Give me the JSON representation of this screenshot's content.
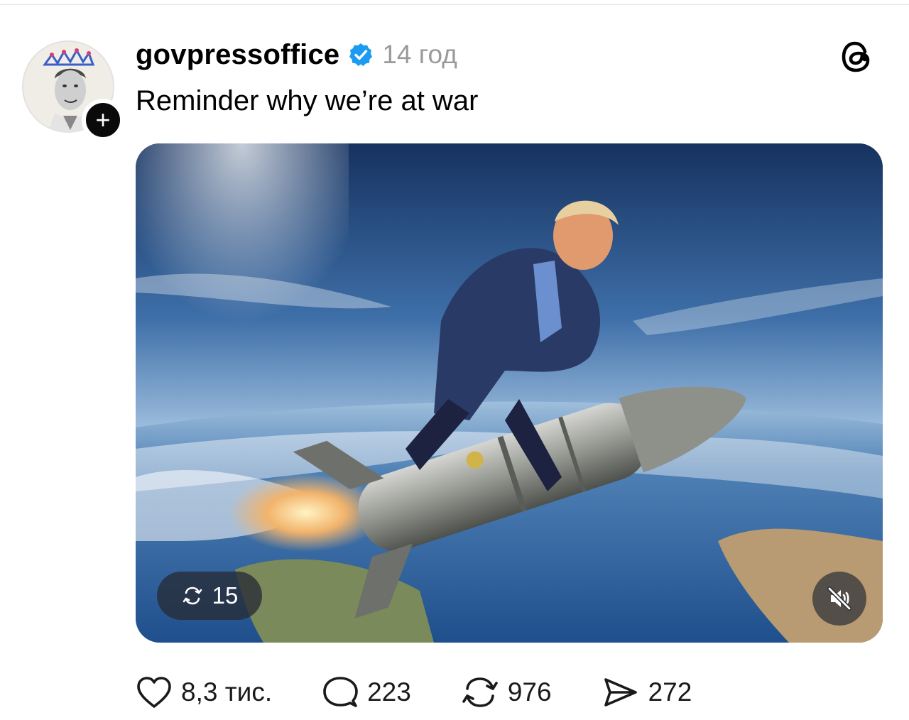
{
  "post": {
    "username": "govpressoffice",
    "time": "14 год",
    "text": "Reminder why we’re at war"
  },
  "media": {
    "repost_count": "15"
  },
  "actions": {
    "likes": "8,3 тис.",
    "comments": "223",
    "reposts": "976",
    "shares": "272"
  },
  "colors": {
    "verified": "#1d9bf0",
    "text": "#000000",
    "muted": "#9a9a9a",
    "sky_top": "#1d3f73",
    "sky_horizon": "#a8c6e2",
    "ocean": "#2c5d94"
  },
  "icons": {
    "avatar": "crowned-portrait",
    "follow": "plus-icon",
    "verified": "verified-badge-icon",
    "threads": "threads-logo-icon",
    "repost_chip": "repost-icon",
    "mute": "speaker-muted-icon",
    "like": "heart-icon",
    "comment": "comment-bubble-icon",
    "repost": "repost-icon",
    "share": "send-icon"
  }
}
